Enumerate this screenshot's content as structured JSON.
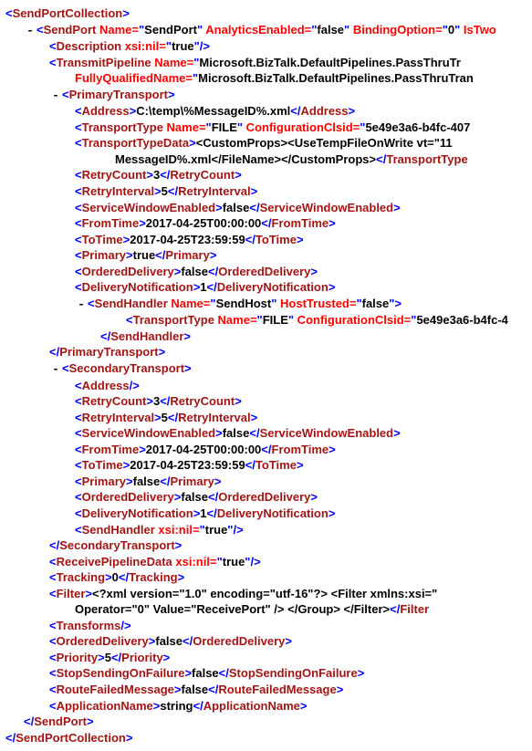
{
  "root": {
    "open": "<SendPortCollection>",
    "close": "</SendPortCollection>"
  },
  "sendPort": {
    "open1": "<SendPort ",
    "attrName": "Name=",
    "nameVal": "\"SendPort\"",
    "attrAnalytics": " AnalyticsEnabled=",
    "analyticsVal": "\"false\"",
    "attrBinding": " BindingOption=",
    "bindingVal": "\"0\"",
    "attrIsTwo": " IsTwo",
    "close": "</SendPort>"
  },
  "description": {
    "open": "<Description ",
    "attr": "xsi:nil=",
    "val": "\"true\"",
    "end": "/>"
  },
  "transmitPipeline": {
    "open": "<TransmitPipeline ",
    "attrName": "Name=",
    "nameVal": "\"Microsoft.BizTalk.DefaultPipelines.PassThruTr",
    "attrFQN": "FullyQualifiedName=",
    "fqnVal": "\"Microsoft.BizTalk.DefaultPipelines.PassThruTran"
  },
  "primaryTransport": {
    "open": "<PrimaryTransport>",
    "close": "</PrimaryTransport>"
  },
  "address": {
    "open": "<Address>",
    "val": "C:\\temp\\%MessageID%.xml",
    "close": "</Address>"
  },
  "transportType": {
    "open": "<TransportType ",
    "attrName": "Name=",
    "nameVal": "\"FILE\"",
    "attrCfg": " ConfigurationClsid=",
    "cfgVal": "\"5e49e3a6-b4fc-407"
  },
  "transportTypeData": {
    "open": "<TransportTypeData>",
    "val1": "<CustomProps><UseTempFileOnWrite vt=\"11",
    "val2": "MessageID%.xml</FileName></CustomProps>",
    "close": "</TransportType"
  },
  "retryCount": {
    "open": "<RetryCount>",
    "val": "3",
    "close": "</RetryCount>"
  },
  "retryInterval": {
    "open": "<RetryInterval>",
    "val": "5",
    "close": "</RetryInterval>"
  },
  "serviceWindow": {
    "open": "<ServiceWindowEnabled>",
    "val": "false",
    "close": "</ServiceWindowEnabled>"
  },
  "fromTime": {
    "open": "<FromTime>",
    "val": "2017-04-25T00:00:00",
    "close": "</FromTime>"
  },
  "toTime": {
    "open": "<ToTime>",
    "val": "2017-04-25T23:59:59",
    "close": "</ToTime>"
  },
  "primary": {
    "open": "<Primary>",
    "val": "true",
    "close": "</Primary>"
  },
  "orderedDelivery": {
    "open": "<OrderedDelivery>",
    "val": "false",
    "close": "</OrderedDelivery>"
  },
  "deliveryNotification": {
    "open": "<DeliveryNotification>",
    "val": "1",
    "close": "</DeliveryNotification>"
  },
  "sendHandler": {
    "open": "<SendHandler ",
    "attrName": "Name=",
    "nameVal": "\"SendHost\"",
    "attrHost": " HostTrusted=",
    "hostVal": "\"false\"",
    "end": ">",
    "close": "</SendHandler>"
  },
  "sendHandlerTT": {
    "open": "<TransportType ",
    "attrName": "Name=",
    "nameVal": "\"FILE\"",
    "attrCfg": " ConfigurationClsid=",
    "cfgVal": "\"5e49e3a6-b4fc-4"
  },
  "secondaryTransport": {
    "open": "<SecondaryTransport>",
    "close": "</SecondaryTransport>"
  },
  "address2": {
    "open": "<Address",
    "close": "/>"
  },
  "primary2": {
    "open": "<Primary>",
    "val": "false",
    "close": "</Primary>"
  },
  "sendHandler2": {
    "open": "<SendHandler ",
    "attr": "xsi:nil=",
    "val": "\"true\"",
    "end": "/>"
  },
  "receivePipelineData": {
    "open": "<ReceivePipelineData ",
    "attr": "xsi:nil=",
    "val": "\"true\"",
    "end": "/>"
  },
  "tracking": {
    "open": "<Tracking>",
    "val": "0",
    "close": "</Tracking>"
  },
  "filter": {
    "open": "<Filter>",
    "val1": "<?xml version=\"1.0\" encoding=\"utf-16\"?> <Filter xmlns:xsi=\"",
    "val2": "Operator=\"0\" Value=\"ReceivePort\" /> </Group> </Filter>",
    "close": "</Filter"
  },
  "transforms": {
    "open": "<Transforms",
    "close": "/>"
  },
  "orderedDelivery2": {
    "open": "<OrderedDelivery>",
    "val": "false",
    "close": "</OrderedDelivery>"
  },
  "priority": {
    "open": "<Priority>",
    "val": "5",
    "close": "</Priority>"
  },
  "stopSending": {
    "open": "<StopSendingOnFailure>",
    "val": "false",
    "close": "</StopSendingOnFailure>"
  },
  "routeFailed": {
    "open": "<RouteFailedMessage>",
    "val": "false",
    "close": "</RouteFailedMessage>"
  },
  "appName": {
    "open": "<ApplicationName>",
    "val": "string",
    "close": "</ApplicationName>"
  },
  "toggle": "-"
}
